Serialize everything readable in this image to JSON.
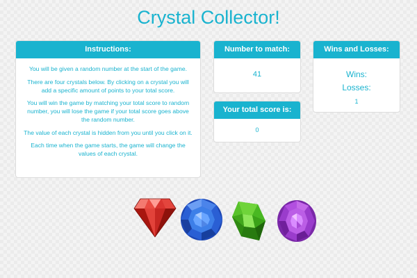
{
  "page": {
    "title": "Crystal Collector!"
  },
  "instructions": {
    "heading": "Instructions:",
    "paragraphs": [
      "You will be given a random number at the start of the game.",
      "There are four crystals below. By clicking on a crystal you will add a specific amount of points to your total score.",
      "You will win the game by matching your total score to random number, you will lose the game if your total score goes above the random number.",
      "The value of each crystal is hidden from you until you click on it.",
      "Each time when the game starts, the game will change the values of each crystal."
    ]
  },
  "match": {
    "heading": "Number to match:",
    "value": "41"
  },
  "score": {
    "heading": "Your total score is:",
    "value": "0"
  },
  "record": {
    "heading": "Wins and Losses:",
    "wins_label": "Wins:",
    "losses_label": "Losses:",
    "losses_value": "1"
  },
  "crystals": [
    {
      "icon": "red-crystal-icon",
      "color": "#e0322e"
    },
    {
      "icon": "blue-crystal-icon",
      "color": "#2c63d6"
    },
    {
      "icon": "green-crystal-icon",
      "color": "#3cab1f"
    },
    {
      "icon": "purple-crystal-icon",
      "color": "#a23fd1"
    }
  ],
  "colors": {
    "accent": "#19b3cf",
    "panel_header_text": "#ffffff"
  }
}
